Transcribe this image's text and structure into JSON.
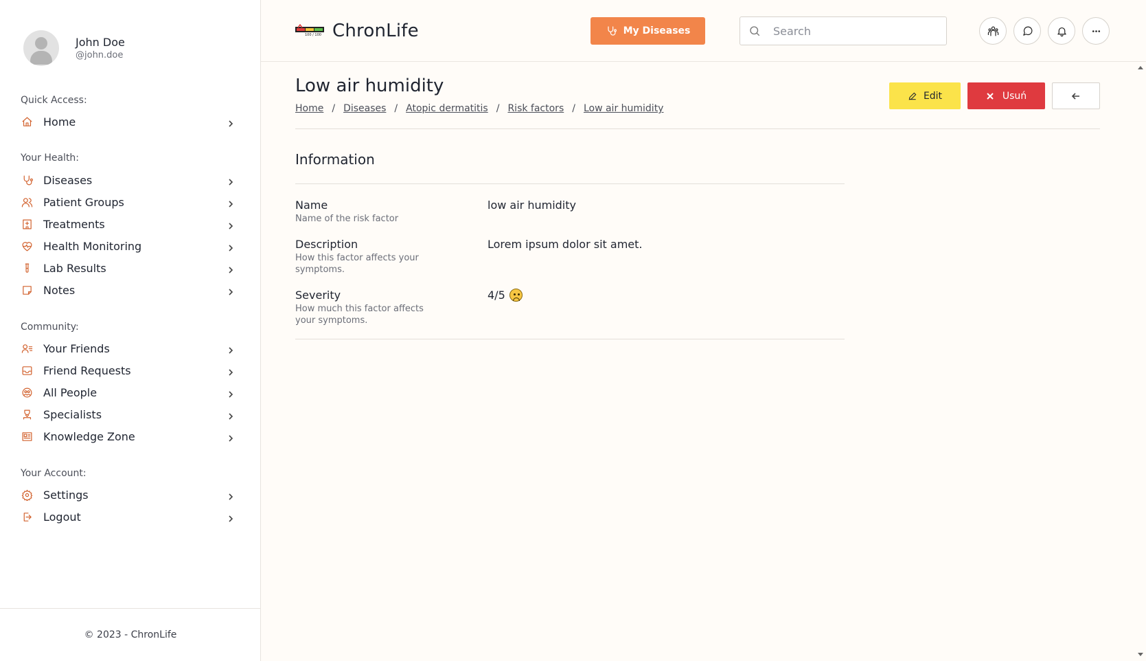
{
  "user": {
    "name": "John Doe",
    "handle": "@john.doe"
  },
  "sidebar": {
    "sections": [
      {
        "label": "Quick Access:",
        "items": [
          {
            "label": "Home",
            "icon": "home-icon"
          }
        ]
      },
      {
        "label": "Your Health:",
        "items": [
          {
            "label": "Diseases",
            "icon": "stethoscope-icon"
          },
          {
            "label": "Patient Groups",
            "icon": "users-icon"
          },
          {
            "label": "Treatments",
            "icon": "hospital-icon"
          },
          {
            "label": "Health Monitoring",
            "icon": "heart-pulse-icon"
          },
          {
            "label": "Lab Results",
            "icon": "test-tube-icon"
          },
          {
            "label": "Notes",
            "icon": "sticky-note-icon"
          }
        ]
      },
      {
        "label": "Community:",
        "items": [
          {
            "label": "Your Friends",
            "icon": "user-list-icon"
          },
          {
            "label": "Friend Requests",
            "icon": "inbox-icon"
          },
          {
            "label": "All People",
            "icon": "globe-people-icon"
          },
          {
            "label": "Specialists",
            "icon": "doctor-icon"
          },
          {
            "label": "Knowledge Zone",
            "icon": "newspaper-icon"
          }
        ]
      },
      {
        "label": "Your Account:",
        "items": [
          {
            "label": "Settings",
            "icon": "gear-icon"
          },
          {
            "label": "Logout",
            "icon": "logout-icon"
          }
        ]
      }
    ],
    "footer": "© 2023 - ChronLife"
  },
  "header": {
    "app_name": "ChronLife",
    "logo_caption": "100 / 100",
    "my_diseases_label": "My Diseases",
    "search_placeholder": "Search"
  },
  "page": {
    "title": "Low air humidity",
    "breadcrumb": [
      "Home",
      "Diseases",
      "Atopic dermatitis",
      "Risk factors",
      "Low air humidity"
    ],
    "buttons": {
      "edit": "Edit",
      "delete": "Usuń"
    },
    "info_heading": "Information",
    "fields": [
      {
        "label": "Name",
        "help": "Name of the risk factor",
        "value": "low air humidity"
      },
      {
        "label": "Description",
        "help": "How this factor affects your symptoms.",
        "value": "Lorem ipsum dolor sit amet."
      },
      {
        "label": "Severity",
        "help": "How much this factor affects your symptoms.",
        "value": "4/5"
      }
    ]
  },
  "colors": {
    "accent": "#f2854a",
    "icon": "#d2622e",
    "edit": "#fbe34a",
    "delete": "#df3a3f"
  }
}
